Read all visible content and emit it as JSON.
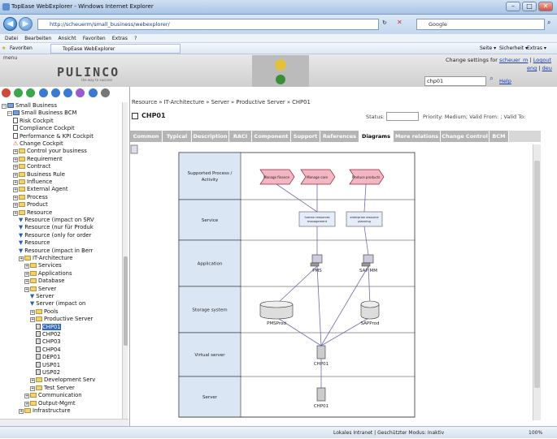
{
  "window": {
    "title": "TopEase WebExplorer - Windows Internet Explorer",
    "min_label": "–",
    "max_label": "□",
    "close_label": "✕"
  },
  "browser": {
    "back_label": "◀",
    "forward_label": "▶",
    "address": "http://scheuerm/small_business/webexplorer/",
    "search_engine": "Google",
    "menu": [
      "Datei",
      "Bearbeiten",
      "Ansicht",
      "Favoriten",
      "Extras",
      "?"
    ],
    "favorites_label": "Favoriten",
    "tab_label": "TopEase WebExplorer",
    "tools": [
      "Seite ▾",
      "Sicherheit ▾",
      "Extras ▾"
    ]
  },
  "header": {
    "menu_label": "menu",
    "logo": "PULINCO",
    "tagline": "the way to success",
    "change_settings_prefix": "Change settings for",
    "user": "scheuer_m",
    "logout": "Logout",
    "lang_en": "eng",
    "lang_de": "deu",
    "search_value": "chp01",
    "help": "Help"
  },
  "tree": [
    {
      "label": "Small Business",
      "indent": 0,
      "type": "root"
    },
    {
      "label": "Small Business BCM",
      "indent": 1,
      "type": "root"
    },
    {
      "label": "Risk Cockpit",
      "indent": 2,
      "type": "doc"
    },
    {
      "label": "Compliance Cockpit",
      "indent": 2,
      "type": "doc"
    },
    {
      "label": "Performance & KPI Cockpit",
      "indent": 2,
      "type": "doc"
    },
    {
      "label": "Change Cockpit",
      "indent": 2,
      "type": "warn"
    },
    {
      "label": "Control your business",
      "indent": 2,
      "type": "folder"
    },
    {
      "label": "Requirement",
      "indent": 2,
      "type": "folder"
    },
    {
      "label": "Contract",
      "indent": 2,
      "type": "folder"
    },
    {
      "label": "Business Rule",
      "indent": 2,
      "type": "folder"
    },
    {
      "label": "Influence",
      "indent": 2,
      "type": "folder"
    },
    {
      "label": "External Agent",
      "indent": 2,
      "type": "folder"
    },
    {
      "label": "Process",
      "indent": 2,
      "type": "folder"
    },
    {
      "label": "Product",
      "indent": 2,
      "type": "folder"
    },
    {
      "label": "Resource",
      "indent": 2,
      "type": "folder"
    },
    {
      "label": "Resource (impact on SRV",
      "indent": 3,
      "type": "filter"
    },
    {
      "label": "Resource (nur für Produk",
      "indent": 3,
      "type": "filter"
    },
    {
      "label": "Resource (only for order",
      "indent": 3,
      "type": "filter"
    },
    {
      "label": "Resource",
      "indent": 3,
      "type": "filter"
    },
    {
      "label": "Resource (impact in Berr",
      "indent": 3,
      "type": "filter"
    },
    {
      "label": "IT-Architecture",
      "indent": 3,
      "type": "folder"
    },
    {
      "label": "Services",
      "indent": 4,
      "type": "folder"
    },
    {
      "label": "Applications",
      "indent": 4,
      "type": "folder"
    },
    {
      "label": "Database",
      "indent": 4,
      "type": "folder"
    },
    {
      "label": "Server",
      "indent": 4,
      "type": "folder"
    },
    {
      "label": "Server",
      "indent": 5,
      "type": "filter"
    },
    {
      "label": "Server (impact on",
      "indent": 5,
      "type": "filter"
    },
    {
      "label": "Pools",
      "indent": 5,
      "type": "folder"
    },
    {
      "label": "Productive Server",
      "indent": 5,
      "type": "folder"
    },
    {
      "label": "CHP01",
      "indent": 6,
      "type": "item",
      "selected": true
    },
    {
      "label": "CHP02",
      "indent": 6,
      "type": "item"
    },
    {
      "label": "CHP03",
      "indent": 6,
      "type": "item"
    },
    {
      "label": "CHP04",
      "indent": 6,
      "type": "item"
    },
    {
      "label": "DEP01",
      "indent": 6,
      "type": "item"
    },
    {
      "label": "USP01",
      "indent": 6,
      "type": "item"
    },
    {
      "label": "USP02",
      "indent": 6,
      "type": "item"
    },
    {
      "label": "Development Serv",
      "indent": 5,
      "type": "folder"
    },
    {
      "label": "Test Server",
      "indent": 5,
      "type": "folder"
    },
    {
      "label": "Communication",
      "indent": 4,
      "type": "folder"
    },
    {
      "label": "Output-Mgmt",
      "indent": 4,
      "type": "folder"
    },
    {
      "label": "Infrastructure",
      "indent": 3,
      "type": "folder"
    }
  ],
  "main": {
    "breadcrumb": "Resource » IT-Architecture » Server » Productive Server » CHP01",
    "title": "CHP01",
    "status_label": "Status:",
    "priority_text": "Priority: Medium; Valid From: ; Valid To:",
    "tabs": [
      "Common",
      "Typical",
      "Description",
      "RACI",
      "Component",
      "Support",
      "References",
      "Diagrams",
      "More relations",
      "Change Control",
      "BCM"
    ],
    "active_tab": "Diagrams"
  },
  "diagram": {
    "lanes": [
      "Supported Process / Activity",
      "Service",
      "Application",
      "Storage system",
      "Virtual server",
      "Server"
    ],
    "processes": [
      "Manage finance",
      "Manage core",
      "Produce products"
    ],
    "services": [
      "human resources management",
      "enterprise resource planning"
    ],
    "apps": [
      "PMS",
      "SAP MM"
    ],
    "storage": [
      "PMSProd",
      "SAPProd"
    ],
    "virtual": "CHP01",
    "server": "CHP01"
  },
  "statusbar": {
    "zone": "Lokales Intranet | Geschützter Modus: Inaktiv",
    "zoom": "100%"
  },
  "colors": {
    "process_fill": "#f4b6c2",
    "process_stroke": "#8a2a3a",
    "lane_label_bg": "#dbe6f4",
    "selected": "#3169c6"
  }
}
